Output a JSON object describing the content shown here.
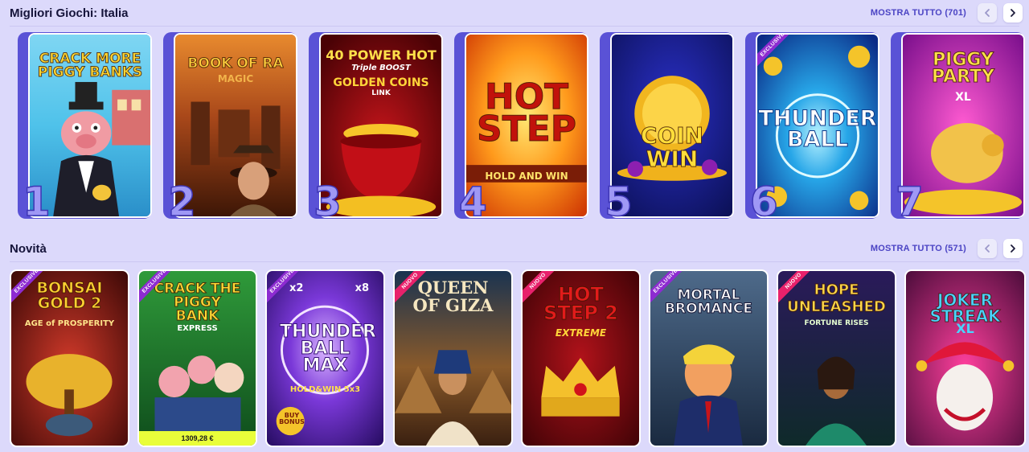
{
  "sections": {
    "top": {
      "title": "Migliori Giochi: Italia",
      "show_all": "MOSTRA TUTTO (701)",
      "games": [
        {
          "rank": "1",
          "title": "CRACK MORE PIGGY BANKS"
        },
        {
          "rank": "2",
          "title": "BOOK OF RA",
          "sub": "MAGIC"
        },
        {
          "rank": "3",
          "title": "40 POWER HOT",
          "sub": "Triple BOOST",
          "sub2": "GOLDEN COINS",
          "sub3": "LINK"
        },
        {
          "rank": "4",
          "title": "HOT STEP",
          "sub": "HOLD AND WIN"
        },
        {
          "rank": "5",
          "title": "COIN WIN"
        },
        {
          "rank": "6",
          "title": "THUNDER BALL",
          "badge": "EXCLUSIVE"
        },
        {
          "rank": "7",
          "title": "PIGGY PARTY",
          "sub": "XL"
        }
      ]
    },
    "new": {
      "title": "Novità",
      "show_all": "MOSTRA TUTTO (571)",
      "games": [
        {
          "title": "BONSAI GOLD 2",
          "sub": "AGE of PROSPERITY",
          "badge": "EXCLUSIVE"
        },
        {
          "title": "CRACK THE PIGGY BANK",
          "sub": "EXPRESS",
          "badge": "EXCLUSIVE",
          "jackpot": "1309,28 €"
        },
        {
          "title": "THUNDER BALL MAX",
          "sub": "HOLD&WIN 5x3",
          "badge": "EXCLUSIVE",
          "extra1": "x2",
          "extra2": "x8",
          "extra3": "BUY BONUS"
        },
        {
          "title": "QUEEN OF GIZA",
          "badge": "NUOVO"
        },
        {
          "title": "HOT STEP 2",
          "sub": "EXTREME",
          "badge": "NUOVO"
        },
        {
          "title": "MORTAL BROMANCE",
          "badge": "EXCLUSIVE"
        },
        {
          "title": "HOPE UNLEASHED",
          "sub": "FORTUNE RISES",
          "badge": "NUOVO"
        },
        {
          "title": "JOKER STREAK",
          "sub": "XL"
        }
      ]
    }
  },
  "colors": {
    "background": "#dcd9fb",
    "accent": "#4b44c4",
    "rank_backing": "#5a52d6",
    "jackpot_bar": "#e9fd3a",
    "badge_exclusive": "#8d2bd1",
    "badge_nuovo": "#e8216b"
  },
  "icons": {
    "prev": "chevron-left-icon",
    "next": "chevron-right-icon"
  }
}
